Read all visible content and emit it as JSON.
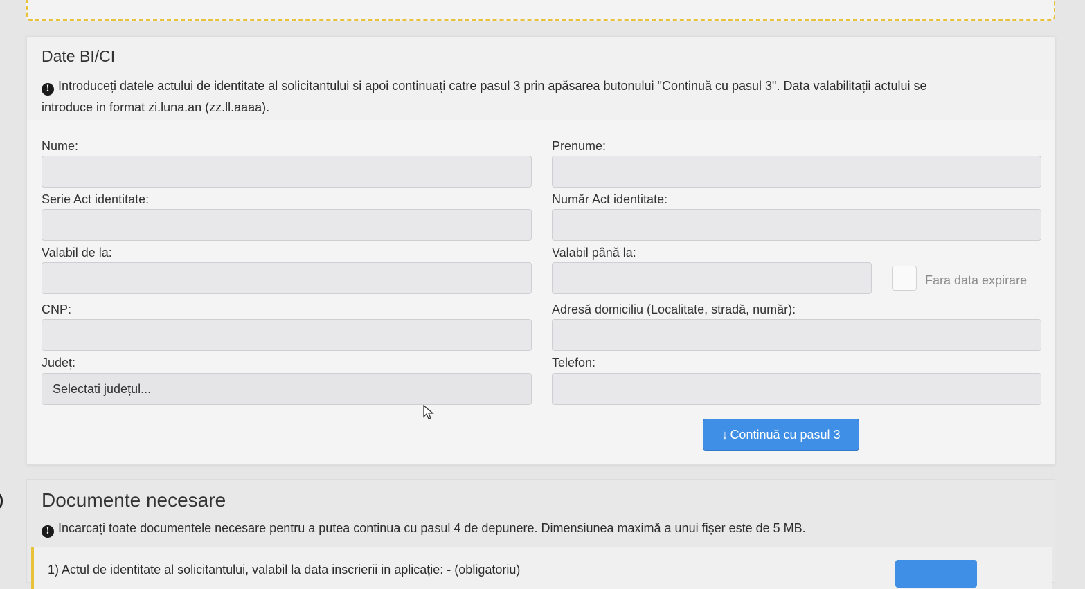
{
  "section1": {
    "title": "Date BI/CI",
    "info_line1": "Introduceți datele actului de identitate al solicitantului si apoi continuați catre pasul 3 prin apăsarea butonului \"Continuă cu pasul 3\". Data valabilitații actului se",
    "info_line2": "introduce in format zi.luna.an (zz.ll.aaaa).",
    "fields": {
      "nume": {
        "label": "Nume:",
        "value": ""
      },
      "prenume": {
        "label": "Prenume:",
        "value": ""
      },
      "serie": {
        "label": "Serie Act identitate:",
        "value": ""
      },
      "numar": {
        "label": "Număr Act identitate:",
        "value": ""
      },
      "valabil_de_la": {
        "label": "Valabil de la:",
        "value": ""
      },
      "valabil_pana_la": {
        "label": "Valabil până la:",
        "value": ""
      },
      "cnp": {
        "label": "CNP:",
        "value": ""
      },
      "adresa": {
        "label": "Adresă domiciliu (Localitate, stradă, număr):",
        "value": ""
      },
      "judet": {
        "label": "Județ:",
        "selected": "Selectati județul..."
      },
      "telefon": {
        "label": "Telefon:",
        "value": ""
      }
    },
    "no_expiry_checkbox": {
      "label": "Fara data expirare",
      "checked": false
    },
    "continue_button": {
      "label": "Continuă cu pasul 3",
      "icon": "arrow-down-icon"
    }
  },
  "section2": {
    "title": "Documente necesare",
    "info": "Incarcați toate documentele necesare pentru a putea continua cu pasul 4 de depunere. Dimensiunea maximă a unui fișer este de 5 MB.",
    "first_doc": "1) Actul de identitate al solicitantului, valabil la data inscrierii in aplicație: - (obligatoriu)"
  },
  "colors": {
    "accent": "#3f8fe6",
    "warning_border": "#e8c23a"
  }
}
